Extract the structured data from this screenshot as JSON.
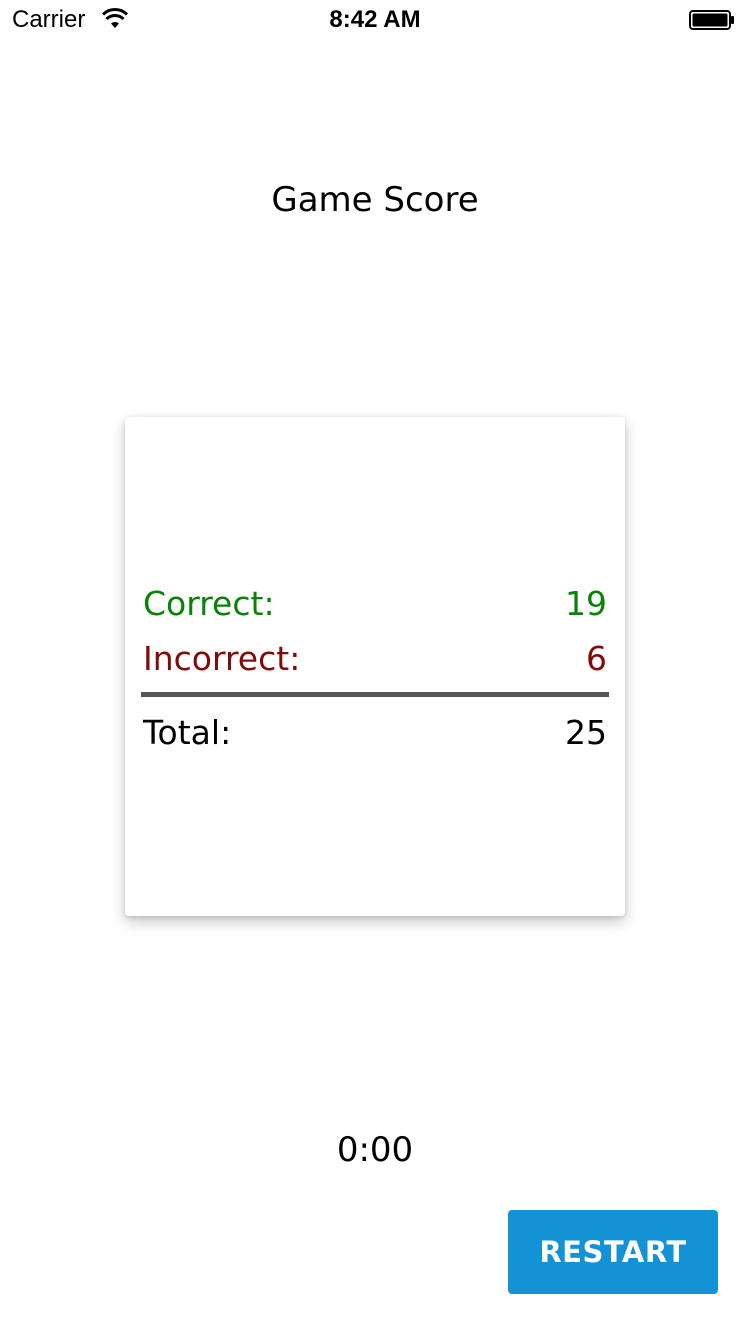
{
  "status_bar": {
    "carrier": "Carrier",
    "time": "8:42 AM",
    "wifi_icon": "wifi-icon",
    "battery_icon": "battery-icon"
  },
  "title": "Game Score",
  "score": {
    "correct_label": "Correct:",
    "correct_value": "19",
    "incorrect_label": "Incorrect:",
    "incorrect_value": "6",
    "total_label": "Total:",
    "total_value": "25"
  },
  "timer": "0:00",
  "restart_label": "RESTART",
  "colors": {
    "correct": "#0a820a",
    "incorrect": "#820a0a",
    "button": "#1392d6",
    "divider": "#555555"
  }
}
